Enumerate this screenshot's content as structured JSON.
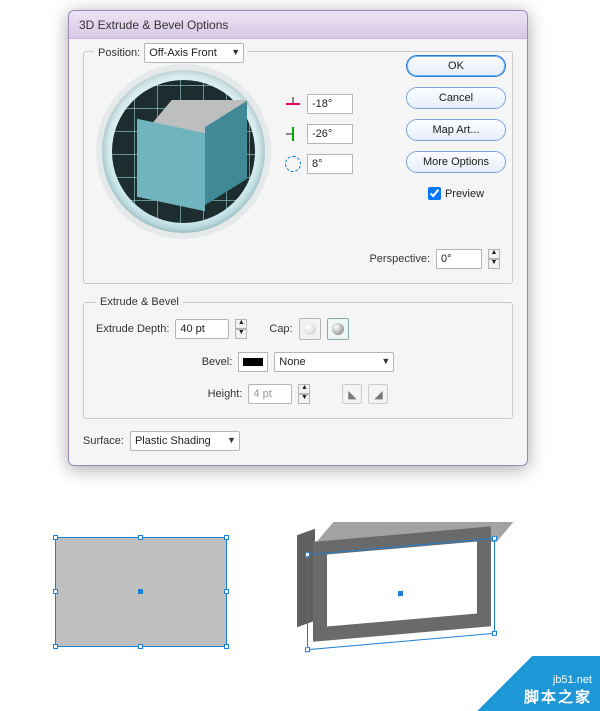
{
  "dialog": {
    "title": "3D Extrude & Bevel Options",
    "position": {
      "label": "Position:",
      "value": "Off-Axis Front"
    },
    "angles": {
      "x": "-18°",
      "y": "-26°",
      "z": "8°"
    },
    "perspective": {
      "label": "Perspective:",
      "value": "0°"
    },
    "extrude_group": {
      "legend": "Extrude & Bevel",
      "depth_label": "Extrude Depth:",
      "depth_value": "40 pt",
      "cap_label": "Cap:",
      "bevel_label": "Bevel:",
      "bevel_value": "None",
      "height_label": "Height:",
      "height_value": "4 pt"
    },
    "surface": {
      "label": "Surface:",
      "value": "Plastic Shading"
    },
    "buttons": {
      "ok": "OK",
      "cancel": "Cancel",
      "map_art": "Map Art...",
      "more_options": "More Options"
    },
    "preview_label": "Preview",
    "preview_checked": true
  },
  "watermark": {
    "url": "jb51.net",
    "cn": "脚本之家"
  }
}
